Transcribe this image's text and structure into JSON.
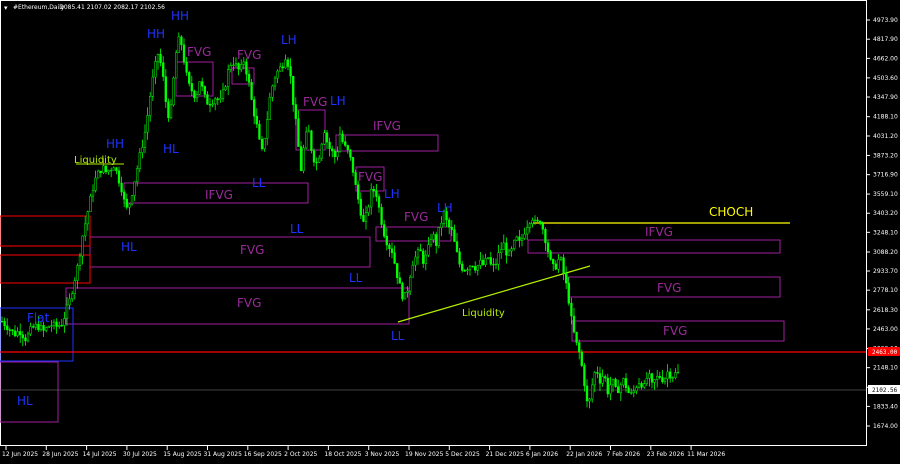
{
  "header": {
    "dropdown_glyph": "▾",
    "symbol": "#Ethereum,Daily",
    "ohlc": "2085.41 2107.02 2082.17 2102.56"
  },
  "colors": {
    "background": "#000000",
    "candle": "#00ff00",
    "blue_label": "#1e32ff",
    "purple": "#a020a0",
    "purple_text": "#9a2a9a",
    "red_line": "#ff0000",
    "yellow": "#ffff00",
    "liquidity": "#b4f000",
    "axis_text": "#ffffff",
    "price_line": "#808080"
  },
  "chart_data": {
    "type": "candlestick",
    "y_ticks": [
      "4973.90",
      "4817.90",
      "4662.00",
      "4503.60",
      "4347.90",
      "4188.10",
      "4031.20",
      "3873.20",
      "3716.90",
      "3559.10",
      "3403.20",
      "3248.10",
      "3088.20",
      "2933.70",
      "2778.10",
      "2618.30",
      "2463.00",
      "2303.10",
      "2148.10",
      "1988.50",
      "1833.40",
      "1674.00"
    ],
    "x_ticks": [
      "12 Jun 2025",
      "28 Jun 2025",
      "14 Jul 2025",
      "30 Jul 2025",
      "15 Aug 2025",
      "31 Aug 2025",
      "16 Sep 2025",
      "2 Oct 2025",
      "18 Oct 2025",
      "3 Nov 2025",
      "19 Nov 2025",
      "5 Dec 2025",
      "21 Dec 2025",
      "6 Jan 2026",
      "22 Jan 2026",
      "7 Feb 2026",
      "23 Feb 2026",
      "11 Mar 2026"
    ],
    "price_tags": {
      "red_level": "2463.00",
      "current": "2102.56"
    },
    "ylim": [
      1674,
      4973.9
    ],
    "close_path": [
      [
        0,
        2540
      ],
      [
        8,
        2480
      ],
      [
        14,
        2420
      ],
      [
        20,
        2450
      ],
      [
        26,
        2380
      ],
      [
        32,
        2470
      ],
      [
        38,
        2490
      ],
      [
        44,
        2440
      ],
      [
        50,
        2500
      ],
      [
        56,
        2480
      ],
      [
        62,
        2510
      ],
      [
        66,
        2600
      ],
      [
        70,
        2700
      ],
      [
        74,
        2850
      ],
      [
        78,
        2980
      ],
      [
        82,
        3200
      ],
      [
        86,
        3350
      ],
      [
        90,
        3500
      ],
      [
        94,
        3650
      ],
      [
        98,
        3720
      ],
      [
        102,
        3780
      ],
      [
        106,
        3740
      ],
      [
        110,
        3760
      ],
      [
        114,
        3800
      ],
      [
        118,
        3700
      ],
      [
        122,
        3600
      ],
      [
        126,
        3420
      ],
      [
        130,
        3500
      ],
      [
        134,
        3650
      ],
      [
        138,
        3800
      ],
      [
        142,
        3950
      ],
      [
        146,
        4100
      ],
      [
        150,
        4350
      ],
      [
        154,
        4550
      ],
      [
        158,
        4700
      ],
      [
        162,
        4580
      ],
      [
        166,
        4300
      ],
      [
        170,
        4150
      ],
      [
        172,
        4350
      ],
      [
        176,
        4700
      ],
      [
        180,
        4850
      ],
      [
        184,
        4650
      ],
      [
        188,
        4450
      ],
      [
        192,
        4400
      ],
      [
        196,
        4350
      ],
      [
        200,
        4500
      ],
      [
        204,
        4350
      ],
      [
        208,
        4300
      ],
      [
        212,
        4320
      ],
      [
        216,
        4350
      ],
      [
        220,
        4300
      ],
      [
        224,
        4400
      ],
      [
        228,
        4550
      ],
      [
        232,
        4650
      ],
      [
        236,
        4600
      ],
      [
        240,
        4550
      ],
      [
        244,
        4650
      ],
      [
        248,
        4500
      ],
      [
        252,
        4300
      ],
      [
        256,
        4150
      ],
      [
        260,
        3950
      ],
      [
        262,
        3900
      ],
      [
        266,
        4100
      ],
      [
        270,
        4350
      ],
      [
        274,
        4500
      ],
      [
        278,
        4560
      ],
      [
        282,
        4600
      ],
      [
        286,
        4700
      ],
      [
        290,
        4550
      ],
      [
        294,
        4250
      ],
      [
        298,
        4000
      ],
      [
        300,
        3700
      ],
      [
        304,
        3950
      ],
      [
        308,
        4100
      ],
      [
        312,
        3900
      ],
      [
        316,
        3800
      ],
      [
        320,
        3900
      ],
      [
        324,
        4100
      ],
      [
        328,
        3950
      ],
      [
        332,
        3900
      ],
      [
        336,
        3850
      ],
      [
        340,
        4050
      ],
      [
        344,
        3950
      ],
      [
        348,
        3900
      ],
      [
        352,
        3800
      ],
      [
        356,
        3600
      ],
      [
        360,
        3450
      ],
      [
        364,
        3300
      ],
      [
        368,
        3450
      ],
      [
        372,
        3600
      ],
      [
        376,
        3580
      ],
      [
        380,
        3400
      ],
      [
        384,
        3250
      ],
      [
        388,
        3150
      ],
      [
        392,
        3100
      ],
      [
        396,
        2950
      ],
      [
        400,
        2800
      ],
      [
        404,
        2700
      ],
      [
        408,
        2800
      ],
      [
        412,
        3000
      ],
      [
        416,
        3050
      ],
      [
        420,
        3100
      ],
      [
        424,
        3000
      ],
      [
        428,
        3100
      ],
      [
        432,
        3250
      ],
      [
        436,
        3150
      ],
      [
        440,
        3300
      ],
      [
        444,
        3400
      ],
      [
        448,
        3300
      ],
      [
        452,
        3250
      ],
      [
        456,
        3100
      ],
      [
        460,
        2980
      ],
      [
        464,
        2950
      ],
      [
        468,
        2970
      ],
      [
        472,
        3000
      ],
      [
        476,
        2960
      ],
      [
        480,
        3000
      ],
      [
        484,
        2980
      ],
      [
        488,
        3050
      ],
      [
        492,
        2950
      ],
      [
        496,
        3000
      ],
      [
        500,
        3100
      ],
      [
        504,
        3150
      ],
      [
        508,
        3050
      ],
      [
        512,
        3100
      ],
      [
        516,
        3200
      ],
      [
        520,
        3150
      ],
      [
        524,
        3250
      ],
      [
        528,
        3330
      ],
      [
        532,
        3380
      ],
      [
        536,
        3300
      ],
      [
        540,
        3350
      ],
      [
        544,
        3250
      ],
      [
        548,
        3100
      ],
      [
        552,
        2950
      ],
      [
        556,
        2980
      ],
      [
        560,
        3050
      ],
      [
        564,
        2900
      ],
      [
        568,
        2750
      ],
      [
        572,
        2500
      ],
      [
        576,
        2350
      ],
      [
        580,
        2250
      ],
      [
        584,
        2050
      ],
      [
        588,
        1800
      ],
      [
        592,
        2000
      ],
      [
        596,
        2150
      ],
      [
        600,
        2050
      ],
      [
        604,
        2100
      ],
      [
        608,
        1950
      ],
      [
        612,
        2050
      ],
      [
        616,
        1950
      ],
      [
        620,
        2000
      ],
      [
        624,
        2050
      ],
      [
        628,
        1950
      ],
      [
        632,
        1920
      ],
      [
        636,
        2000
      ],
      [
        640,
        2050
      ],
      [
        644,
        1980
      ],
      [
        648,
        2100
      ],
      [
        652,
        2000
      ],
      [
        656,
        2060
      ],
      [
        660,
        2080
      ],
      [
        664,
        2050
      ],
      [
        668,
        2120
      ],
      [
        672,
        2080
      ],
      [
        676,
        2100
      ],
      [
        680,
        2102
      ]
    ]
  },
  "annotations": {
    "zones": [
      {
        "kind": "purple",
        "label": "FVG"
      },
      {
        "kind": "purple",
        "label": "FVG"
      },
      {
        "kind": "purple",
        "label": "FVG"
      },
      {
        "kind": "purple",
        "label": "IFVG"
      },
      {
        "kind": "purple",
        "label": "FVG"
      },
      {
        "kind": "purple",
        "label": "FVG"
      },
      {
        "kind": "purple",
        "label": "IFVG"
      },
      {
        "kind": "purple",
        "label": "FVG"
      },
      {
        "kind": "purple",
        "label": "FVG"
      },
      {
        "kind": "purple",
        "label": "FVG"
      },
      {
        "kind": "purple",
        "label": "IFVG"
      },
      {
        "kind": "purple",
        "label": "FVG"
      },
      {
        "kind": "purple",
        "label": "FVG"
      }
    ],
    "swing_labels": [
      "HH",
      "HH",
      "HH",
      "HL",
      "LH",
      "LH",
      "LL",
      "HL",
      "LL",
      "LL",
      "LH",
      "LH",
      "LL",
      "HL"
    ],
    "flat_label": "Flat",
    "liquidity_labels": [
      "Liquidity",
      "Liquidity"
    ],
    "choch_label": "CHOCH"
  }
}
